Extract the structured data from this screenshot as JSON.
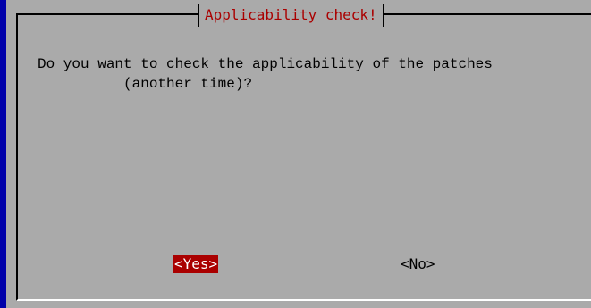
{
  "dialog": {
    "title": "Applicability check!",
    "message_line1": "Do you want to check the applicability of the patches",
    "message_line2": "          (another time)?"
  },
  "buttons": {
    "yes_label": "<Yes>",
    "no_label": "<No>"
  },
  "colors": {
    "screen_background": "#0000aa",
    "dialog_background": "#aaaaaa",
    "title_text": "#aa0000",
    "selected_button_background": "#aa0000",
    "selected_button_text": "#ffffff"
  }
}
